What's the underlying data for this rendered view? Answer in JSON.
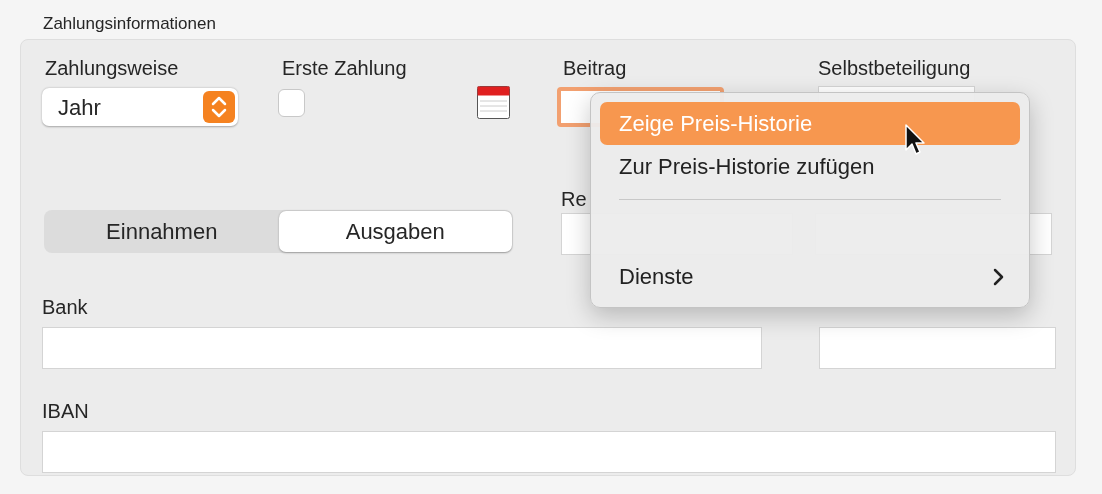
{
  "section_title": "Zahlungsinformationen",
  "payment_method": {
    "label": "Zahlungsweise",
    "value": "Jahr"
  },
  "first_payment": {
    "label": "Erste Zahlung",
    "checked": false
  },
  "contribution": {
    "label": "Beitrag",
    "focused": true
  },
  "deductible": {
    "label": "Selbstbeteiligung"
  },
  "partial_field": {
    "label": "Re"
  },
  "segments": [
    {
      "label": "Einnahmen",
      "selected": false
    },
    {
      "label": "Ausgaben",
      "selected": true
    }
  ],
  "bank": {
    "label": "Bank"
  },
  "iban": {
    "label": "IBAN"
  },
  "context_menu": {
    "items": [
      {
        "kind": "item",
        "label": "Zeige Preis-Historie",
        "selected": true
      },
      {
        "kind": "item",
        "label": "Zur Preis-Historie zufügen",
        "selected": false
      },
      {
        "kind": "separator"
      },
      {
        "kind": "blank"
      },
      {
        "kind": "submenu",
        "label": "Dienste",
        "selected": false
      }
    ]
  }
}
